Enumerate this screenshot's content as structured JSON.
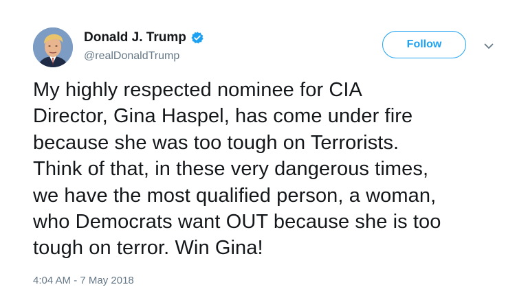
{
  "author": {
    "name": "Donald J. Trump",
    "handle": "@realDonaldTrump",
    "verified": true
  },
  "follow_button": {
    "label": "Follow"
  },
  "tweet": {
    "text": "My highly respected nominee for CIA\nDirector, Gina Haspel, has come under fire\nbecause she was too tough on Terrorists.\nThink of that, in these very dangerous times,\nwe have the most qualified person, a woman,\nwho Democrats want OUT because she is too\ntough on terror. Win Gina!",
    "timestamp": "4:04 AM - 7 May 2018"
  },
  "icons": {
    "verified": "verified-badge-icon",
    "more": "chevron-down-icon",
    "avatar": "profile-photo"
  },
  "colors": {
    "accent": "#1da1f2",
    "text": "#14171a",
    "secondary": "#657786"
  }
}
